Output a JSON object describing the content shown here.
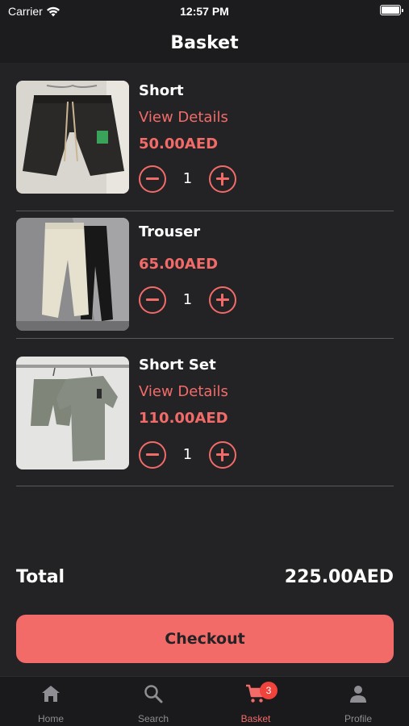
{
  "status_bar": {
    "carrier": "Carrier",
    "time": "12:57 PM"
  },
  "header": {
    "title": "Basket"
  },
  "items": [
    {
      "name": "Short",
      "details_label": "View Details",
      "price": "50.00AED",
      "quantity": "1"
    },
    {
      "name": "Trouser",
      "price": "65.00AED",
      "quantity": "1"
    },
    {
      "name": "Short Set",
      "details_label": "View Details",
      "price": "110.00AED",
      "quantity": "1"
    }
  ],
  "total": {
    "label": "Total",
    "value": "225.00AED"
  },
  "checkout": {
    "label": "Checkout"
  },
  "tab_bar": {
    "tabs": [
      {
        "label": "Home",
        "icon": "home-icon"
      },
      {
        "label": "Search",
        "icon": "search-icon"
      },
      {
        "label": "Basket",
        "icon": "cart-icon",
        "badge": "3",
        "active": true
      },
      {
        "label": "Profile",
        "icon": "person-icon"
      }
    ]
  },
  "colors": {
    "accent": "#f26b69",
    "background": "#232325",
    "badge": "#f0433c"
  }
}
